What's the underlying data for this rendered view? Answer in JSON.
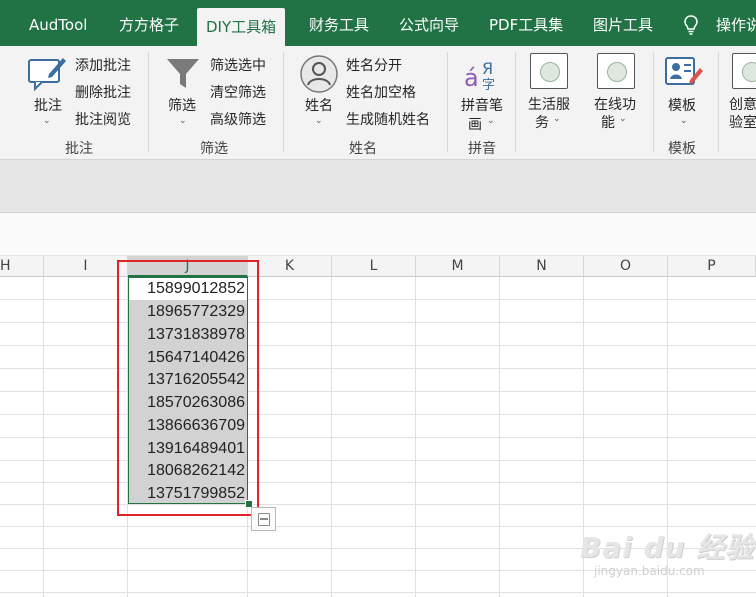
{
  "tabs": [
    {
      "label": "AudTool"
    },
    {
      "label": "方方格子"
    },
    {
      "label": "DIY工具箱"
    },
    {
      "label": "财务工具"
    },
    {
      "label": "公式向导"
    },
    {
      "label": "PDF工具集"
    },
    {
      "label": "图片工具"
    },
    {
      "label": "操作说"
    }
  ],
  "ribbon": {
    "annotation": {
      "big": "批注",
      "add": "添加批注",
      "delete": "删除批注",
      "read": "批注阅览",
      "group": "批注"
    },
    "filter": {
      "big": "筛选",
      "filter_selected": "筛选选中",
      "clear": "清空筛选",
      "advanced": "高级筛选",
      "group": "筛选"
    },
    "name": {
      "big": "姓名",
      "split": "姓名分开",
      "add_space": "姓名加空格",
      "random": "生成随机姓名",
      "group": "姓名"
    },
    "pinyin": {
      "big_line1": "拼音笔",
      "big_line2": "画",
      "group": "拼音"
    },
    "life": {
      "line1": "生活服",
      "line2": "务"
    },
    "online": {
      "line1": "在线功",
      "line2": "能"
    },
    "template": {
      "big": "模板",
      "group": "模板"
    },
    "creative": {
      "line1": "创意",
      "line2": "验室"
    }
  },
  "columns": [
    "H",
    "I",
    "J",
    "K",
    "L",
    "M",
    "N",
    "O",
    "P"
  ],
  "cells": [
    "15899012852",
    "18965772329",
    "13731838978",
    "15647140426",
    "13716205542",
    "18570263086",
    "13866636709",
    "13916489401",
    "18068262142",
    "13751799852"
  ],
  "watermark": {
    "main": "Bai du 经验",
    "sub": "jingyan.baidu.com"
  },
  "colors": {
    "accent": "#217346",
    "highlight_box": "#e0232a"
  }
}
